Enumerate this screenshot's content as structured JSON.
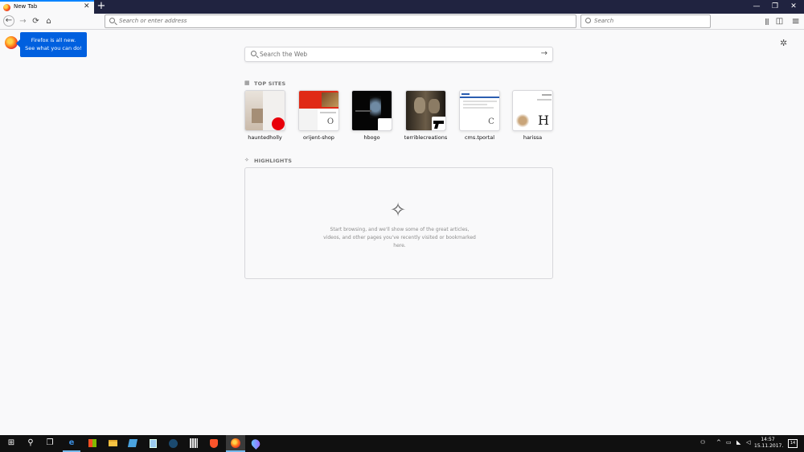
{
  "tab": {
    "title": "New Tab",
    "close": "✕"
  },
  "tabbar": {
    "new_tab": "+",
    "minimize": "—",
    "restore": "❐",
    "close": "✕"
  },
  "nav": {
    "back_icon": "←",
    "forward_icon": "→",
    "reload_icon": "⟳",
    "home_icon": "⌂",
    "url_placeholder": "Search or enter address",
    "search_placeholder": "Search",
    "library_icon": "|||",
    "sidebar_icon": "◫",
    "menu_icon": "≡"
  },
  "onboarding": {
    "line1": "Firefox is all new.",
    "line2": "See what you can do!"
  },
  "settings_icon": "✲",
  "websearch": {
    "placeholder": "Search the Web",
    "go_icon": "→"
  },
  "top_sites": {
    "title": "TOP SITES",
    "icon": "▦",
    "sites": [
      {
        "label": "hauntedholly",
        "favicon": ""
      },
      {
        "label": "orijent-shop",
        "favicon": "O"
      },
      {
        "label": "hbogo",
        "favicon": ""
      },
      {
        "label": "terriblecreations",
        "favicon": ""
      },
      {
        "label": "cms.tportal",
        "favicon": "C"
      },
      {
        "label": "harissa",
        "favicon": "H"
      }
    ]
  },
  "highlights": {
    "title": "HIGHLIGHTS",
    "icon": "✧",
    "spark": "✧",
    "message_line1": "Start browsing, and we'll show some of the great articles,",
    "message_line2": "videos, and other pages you've recently visited or bookmarked",
    "message_line3": "here."
  },
  "taskbar": {
    "start_icon": "⊞",
    "search_icon": "⚲",
    "taskview_icon": "❐",
    "clock_time": "14:57",
    "clock_date": "15.11.2017.",
    "notification_count": "14"
  },
  "colors": {
    "accent": "#0a84ff",
    "notice": "#0060df",
    "tabbar": "#202340"
  }
}
